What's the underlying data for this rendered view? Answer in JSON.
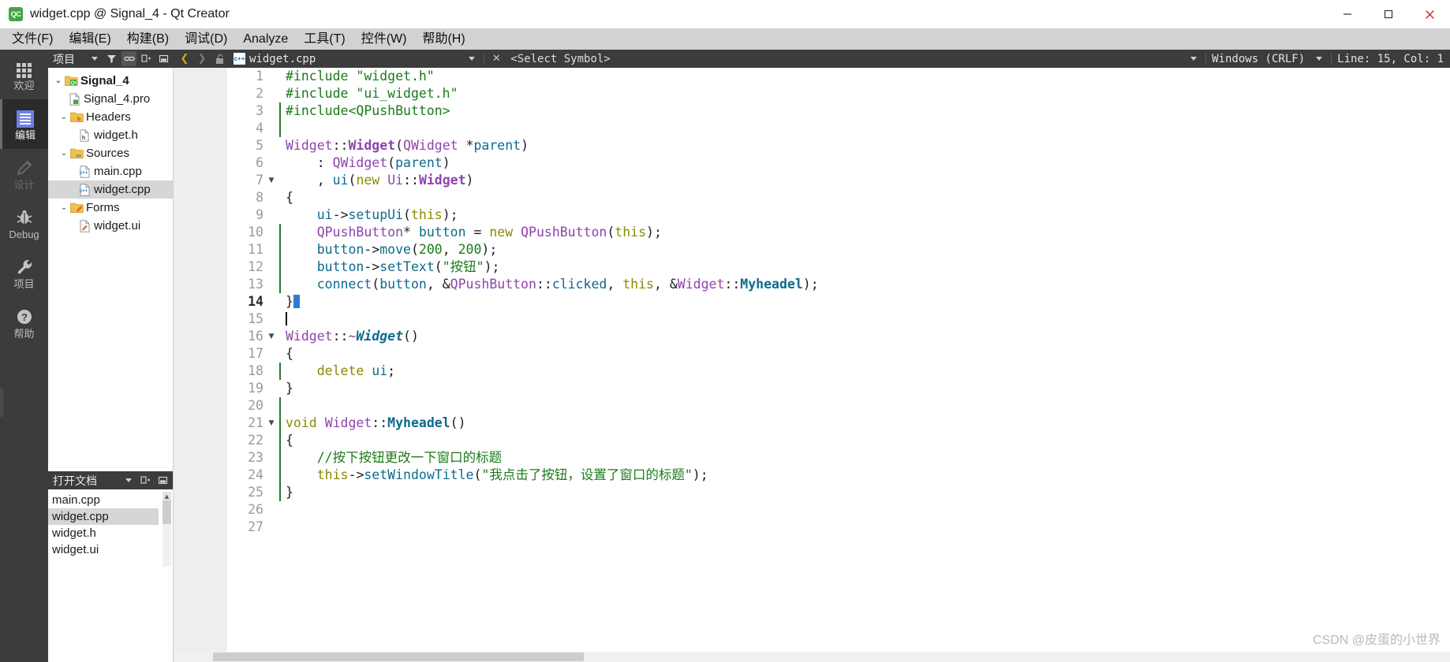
{
  "window": {
    "title": "widget.cpp @ Signal_4 - Qt Creator",
    "logo_text": "QC",
    "minimize": "—",
    "maximize": "☐",
    "close": "✕"
  },
  "menubar": {
    "items": [
      {
        "label": "文件(F)"
      },
      {
        "label": "编辑(E)"
      },
      {
        "label": "构建(B)"
      },
      {
        "label": "调试(D)"
      },
      {
        "label": "Analyze"
      },
      {
        "label": "工具(T)"
      },
      {
        "label": "控件(W)"
      },
      {
        "label": "帮助(H)"
      }
    ]
  },
  "modebar": {
    "items": [
      {
        "label": "欢迎",
        "icon": "grid-icon",
        "state": "normal"
      },
      {
        "label": "编辑",
        "icon": "document-lines-icon",
        "state": "active"
      },
      {
        "label": "设计",
        "icon": "pencil-icon",
        "state": "disabled"
      },
      {
        "label": "Debug",
        "icon": "bug-icon",
        "state": "normal"
      },
      {
        "label": "项目",
        "icon": "wrench-icon",
        "state": "normal"
      },
      {
        "label": "帮助",
        "icon": "question-circle-icon",
        "state": "normal"
      }
    ]
  },
  "project_panel": {
    "header": {
      "title": "项目",
      "dropdown_icon": "chevron-down-icon",
      "filter_icon": "filter-icon",
      "link_icon": "link-icon",
      "expand_icon": "expand-all-icon",
      "collapse_icon": "collapse-icon"
    },
    "tree": [
      {
        "label": "Signal_4",
        "depth": 0,
        "icon": "qt-folder-icon",
        "expander": "⌄",
        "bold": true,
        "selected": false
      },
      {
        "label": "Signal_4.pro",
        "depth": 1,
        "icon": "pro-file-icon",
        "expander": "",
        "bold": false,
        "selected": false
      },
      {
        "label": "Headers",
        "depth": 1,
        "icon": "h-folder-icon",
        "expander": "⌄",
        "bold": false,
        "selected": false
      },
      {
        "label": "widget.h",
        "depth": 2,
        "icon": "h-file-icon",
        "expander": "",
        "bold": false,
        "selected": false
      },
      {
        "label": "Sources",
        "depth": 1,
        "icon": "cpp-folder-icon",
        "expander": "⌄",
        "bold": false,
        "selected": false
      },
      {
        "label": "main.cpp",
        "depth": 2,
        "icon": "cpp-file-icon",
        "expander": "",
        "bold": false,
        "selected": false
      },
      {
        "label": "widget.cpp",
        "depth": 2,
        "icon": "cpp-file-icon",
        "expander": "",
        "bold": false,
        "selected": true
      },
      {
        "label": "Forms",
        "depth": 1,
        "icon": "forms-folder-icon",
        "expander": "⌄",
        "bold": false,
        "selected": false
      },
      {
        "label": "widget.ui",
        "depth": 2,
        "icon": "ui-file-icon",
        "expander": "",
        "bold": false,
        "selected": false
      }
    ]
  },
  "open_documents": {
    "header": {
      "title": "打开文档",
      "dropdown_icon": "chevron-down-icon",
      "split_icon": "split-icon",
      "close-icon": "close-split-icon"
    },
    "items": [
      {
        "label": "main.cpp",
        "selected": false
      },
      {
        "label": "widget.cpp",
        "selected": true
      },
      {
        "label": "widget.h",
        "selected": false
      },
      {
        "label": "widget.ui",
        "selected": false
      }
    ]
  },
  "editor_toolbar": {
    "back_icon": "chevron-left-icon",
    "forward_icon": "chevron-right-icon",
    "lock_icon": "unlocked-icon",
    "file_badge": "c++",
    "file_name": "widget.cpp",
    "file_dropdown_icon": "chevron-down-icon",
    "close_icon": "close-icon",
    "symbol_selector": "<Select Symbol>",
    "symbol_dropdown_icon": "chevron-down-icon",
    "line_ending": "Windows (CRLF)",
    "line_ending_dropdown_icon": "chevron-down-icon",
    "cursor_position": "Line: 15, Col: 1"
  },
  "editor": {
    "current_line": 14,
    "lines": [
      {
        "n": 1,
        "fold": "",
        "mark": false,
        "text": "#include \"widget.h\""
      },
      {
        "n": 2,
        "fold": "",
        "mark": false,
        "text": "#include \"ui_widget.h\""
      },
      {
        "n": 3,
        "fold": "",
        "mark": true,
        "text": "#include<QPushButton>"
      },
      {
        "n": 4,
        "fold": "",
        "mark": true,
        "text": ""
      },
      {
        "n": 5,
        "fold": "",
        "mark": false,
        "text": "Widget::Widget(QWidget *parent)"
      },
      {
        "n": 6,
        "fold": "",
        "mark": false,
        "text": "    : QWidget(parent)"
      },
      {
        "n": 7,
        "fold": "▼",
        "mark": false,
        "text": "    , ui(new Ui::Widget)"
      },
      {
        "n": 8,
        "fold": "",
        "mark": false,
        "text": "{"
      },
      {
        "n": 9,
        "fold": "",
        "mark": false,
        "text": "    ui->setupUi(this);"
      },
      {
        "n": 10,
        "fold": "",
        "mark": true,
        "text": "    QPushButton* button = new QPushButton(this);"
      },
      {
        "n": 11,
        "fold": "",
        "mark": true,
        "text": "    button->move(200, 200);"
      },
      {
        "n": 12,
        "fold": "",
        "mark": true,
        "text": "    button->setText(\"按钮\");"
      },
      {
        "n": 13,
        "fold": "",
        "mark": true,
        "text": "    connect(button, &QPushButton::clicked, this, &Widget::Myheadel);"
      },
      {
        "n": 14,
        "fold": "",
        "mark": false,
        "text": "}"
      },
      {
        "n": 15,
        "fold": "",
        "mark": false,
        "text": ""
      },
      {
        "n": 16,
        "fold": "▼",
        "mark": false,
        "text": "Widget::~Widget()"
      },
      {
        "n": 17,
        "fold": "",
        "mark": false,
        "text": "{"
      },
      {
        "n": 18,
        "fold": "",
        "mark": true,
        "text": "    delete ui;"
      },
      {
        "n": 19,
        "fold": "",
        "mark": false,
        "text": "}"
      },
      {
        "n": 20,
        "fold": "",
        "mark": true,
        "text": ""
      },
      {
        "n": 21,
        "fold": "▼",
        "mark": true,
        "text": "void Widget::Myheadel()"
      },
      {
        "n": 22,
        "fold": "",
        "mark": true,
        "text": "{"
      },
      {
        "n": 23,
        "fold": "",
        "mark": true,
        "text": "    //按下按钮更改一下窗口的标题"
      },
      {
        "n": 24,
        "fold": "",
        "mark": true,
        "text": "    this->setWindowTitle(\"我点击了按钮，设置了窗口的标题\");"
      },
      {
        "n": 25,
        "fold": "",
        "mark": true,
        "text": "}"
      },
      {
        "n": 26,
        "fold": "",
        "mark": false,
        "text": ""
      },
      {
        "n": 27,
        "fold": "",
        "mark": false,
        "text": ""
      }
    ]
  },
  "watermark": {
    "text": "CSDN @皮蛋的小世界"
  },
  "colors": {
    "accent_green": "#3fa743",
    "dark_chrome": "#3c3c3c",
    "menu_gray": "#d2d2d2",
    "gutter": "#eeeeee",
    "selection": "#d6d6d6",
    "caret_blue": "#2b7ad1",
    "string_green": "#1b7a1b",
    "type_purple": "#8e44ad",
    "fn_blue": "#0d6a8e",
    "keyword_olive": "#8a8a00"
  }
}
